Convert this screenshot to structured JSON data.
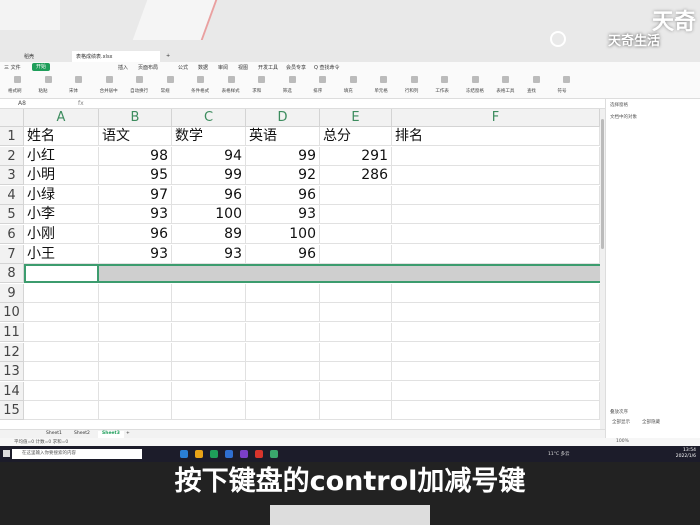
{
  "watermark": {
    "big": "天奇",
    "small": "天奇生活"
  },
  "tabs": [
    "稻壳",
    "表格成绩表.xlsx",
    "+"
  ],
  "menu": [
    "三 文件",
    "开始",
    "插入",
    "页面布局",
    "公式",
    "数据",
    "审阅",
    "视图",
    "开发工具",
    "会员专享",
    "Q 查找命令"
  ],
  "menu_active": "开始",
  "ribbon": [
    "格式刷",
    "粘贴",
    "宋体",
    "合并居中",
    "自动换行",
    "常规",
    "条件格式",
    "表格样式",
    "求和",
    "筛选",
    "排序",
    "填充",
    "单元格",
    "行和列",
    "工作表",
    "冻结窗格",
    "表格工具",
    "查找",
    "符号"
  ],
  "formula_bar": {
    "namebox": "A8",
    "fx": "fx"
  },
  "columns": [
    "A",
    "B",
    "C",
    "D",
    "E",
    "F"
  ],
  "rows": [
    "1",
    "2",
    "3",
    "4",
    "5",
    "6",
    "7",
    "8",
    "9",
    "10",
    "11",
    "12",
    "13",
    "14",
    "15"
  ],
  "table": {
    "header": [
      "姓名",
      "语文",
      "数学",
      "英语",
      "总分",
      "排名"
    ],
    "data": [
      [
        "小红",
        "98",
        "94",
        "99",
        "291",
        ""
      ],
      [
        "小明",
        "95",
        "99",
        "92",
        "286",
        ""
      ],
      [
        "小绿",
        "97",
        "96",
        "96",
        "",
        ""
      ],
      [
        "小李",
        "93",
        "100",
        "93",
        "",
        ""
      ],
      [
        "小刚",
        "96",
        "89",
        "100",
        "",
        ""
      ],
      [
        "小王",
        "93",
        "93",
        "96",
        "",
        ""
      ]
    ]
  },
  "right_panel": {
    "title": "选择窗格",
    "sub": "文档中的对象",
    "btn1": "全部显示",
    "btn2": "全部隐藏",
    "order": "叠放次序"
  },
  "sheet_tabs": [
    "Sheet1",
    "Sheet2",
    "Sheet3",
    "+"
  ],
  "active_sheet": "Sheet3",
  "status": {
    "left": "平均值=0  计数=0  求和=0",
    "zoom": "100%"
  },
  "taskbar": {
    "search": "在这里输入你要搜索的内容",
    "weather": "11°C 多云",
    "time": "13:54",
    "date": "2022/1/6"
  },
  "subtitle": "按下键盘的control加减号键",
  "colors": {
    "accent": "#1e9e5a",
    "header_text": "#3c8c5e"
  }
}
